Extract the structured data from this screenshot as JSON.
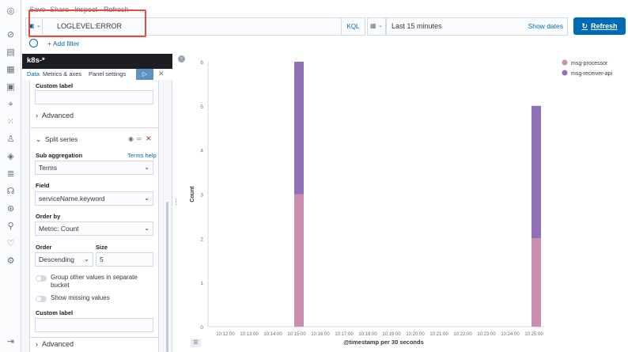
{
  "top_menu": [
    "Save",
    "Share",
    "Inspect",
    "Refresh"
  ],
  "query": {
    "value": "LOGLEVEL:ERROR",
    "language": "KQL"
  },
  "time": {
    "range": "Last 15 minutes",
    "show_dates": "Show dates"
  },
  "refresh_label": "Refresh",
  "add_filter": "+ Add filter",
  "index_pattern": "k8s-*",
  "tabs": [
    "Data",
    "Metrics & axes",
    "Panel settings"
  ],
  "editor": {
    "custom_label_1": "Custom label",
    "advanced_1": "Advanced",
    "split_series": "Split series",
    "sub_aggregation_label": "Sub aggregation",
    "terms_help": "Terms help",
    "sub_aggregation_value": "Terms",
    "field_label": "Field",
    "field_value": "serviceName.keyword",
    "order_by_label": "Order by",
    "order_by_value": "Metric: Count",
    "order_label": "Order",
    "order_value": "Descending",
    "size_label": "Size",
    "size_value": "5",
    "group_other_1": "Group other values in separate",
    "group_other_2": "bucket",
    "show_missing": "Show missing values",
    "custom_label_2": "Custom label",
    "advanced_2": "Advanced"
  },
  "colors": {
    "processor": "#ca8eae",
    "receiver": "#9170b8",
    "accent": "#006bb4"
  },
  "chart_data": {
    "type": "bar",
    "stacked": true,
    "xlabel": "@timestamp per 30 seconds",
    "ylabel": "Count",
    "ylim": [
      0,
      6
    ],
    "yticks": [
      0,
      1,
      2,
      3,
      4,
      5,
      6
    ],
    "categories": [
      "10:12:00",
      "10:13:00",
      "10:14:00",
      "10:15:00",
      "10:16:00",
      "10:17:00",
      "10:18:00",
      "10:19:00",
      "10:20:00",
      "10:21:00",
      "10:22:00",
      "10:23:00",
      "10:24:00",
      "10:25:00"
    ],
    "bars": [
      {
        "x": "10:15:00",
        "msg-processor": 3,
        "msg-receiver-api": 3
      },
      {
        "x": "10:25:00",
        "msg-processor": 2,
        "msg-receiver-api": 3
      }
    ],
    "series": [
      {
        "name": "msg-processor",
        "color": "#ca8eae"
      },
      {
        "name": "msg-receiver-api",
        "color": "#9170b8"
      }
    ],
    "legend": "top-right"
  }
}
